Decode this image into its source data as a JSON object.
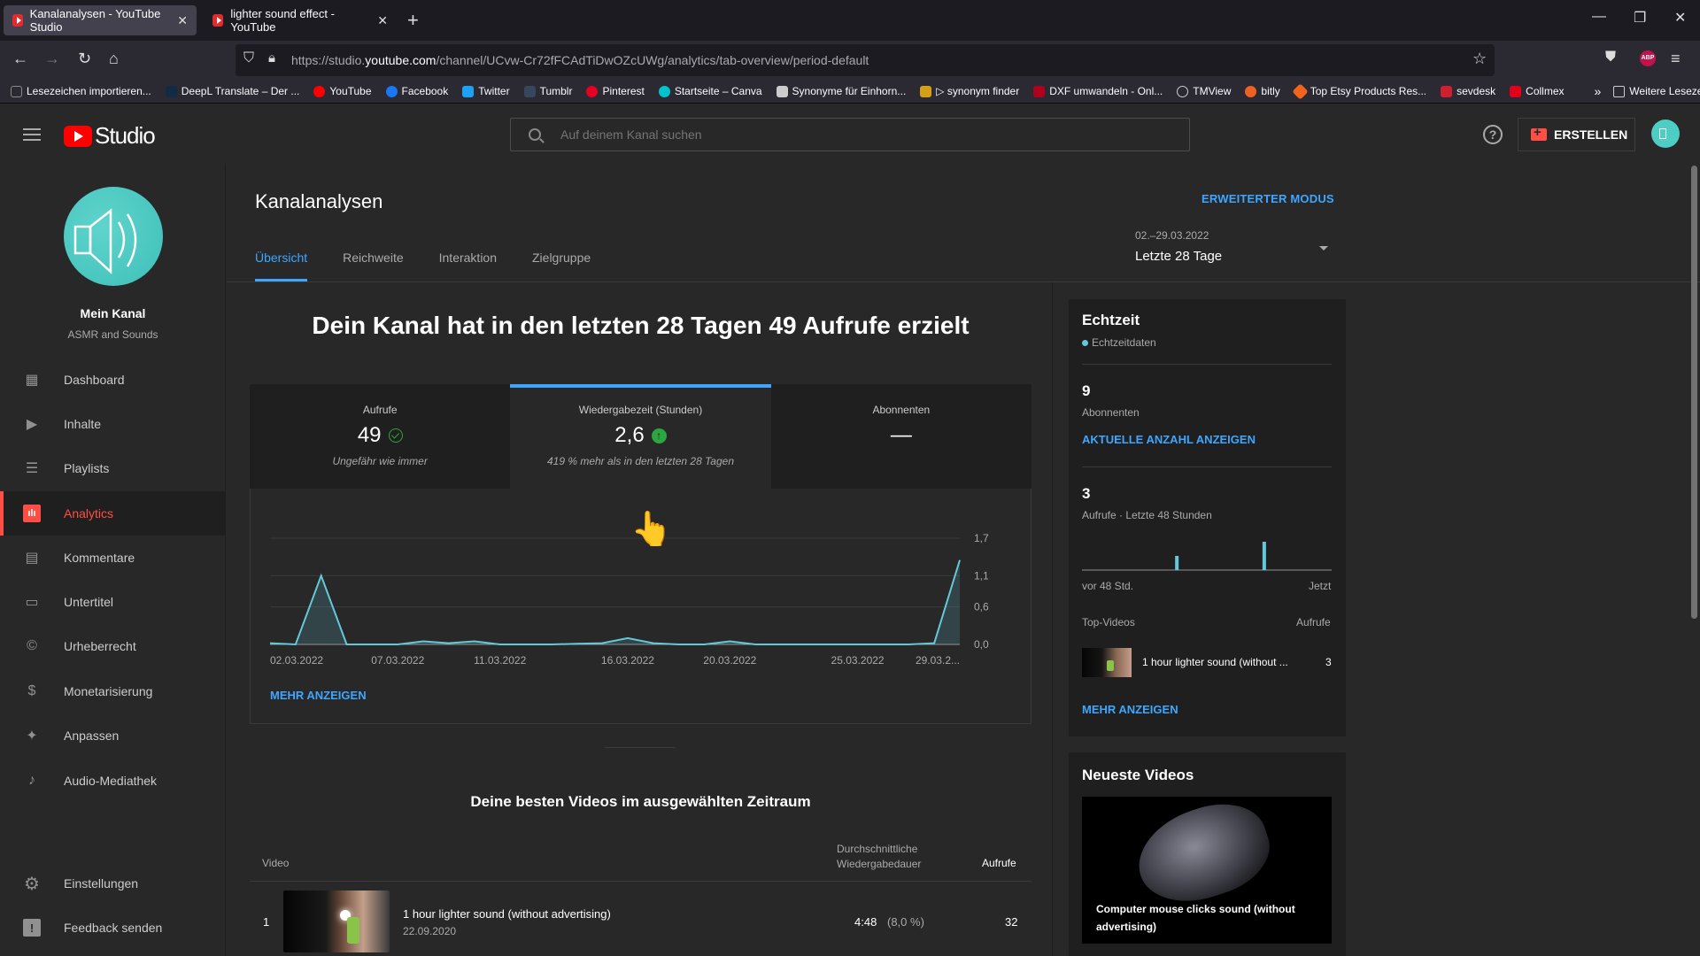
{
  "browser": {
    "tabs": [
      {
        "title": "Kanalanalysen - YouTube Studio",
        "active": true
      },
      {
        "title": "lighter sound effect - YouTube",
        "active": false
      }
    ],
    "url_prefix": "https://studio.",
    "url_domain": "youtube.com",
    "url_path": "/channel/UCvw-Cr72fFCAdTiDwOZcUWg/analytics/tab-overview/period-default",
    "bookmarks": [
      {
        "label": "Lesezeichen importieren...",
        "color": "#888888"
      },
      {
        "label": "DeepL Translate – Der ...",
        "color": "#0f2b46"
      },
      {
        "label": "YouTube",
        "color": "#ff0000"
      },
      {
        "label": "Facebook",
        "color": "#1877f2"
      },
      {
        "label": "Twitter",
        "color": "#1da1f2"
      },
      {
        "label": "Tumblr",
        "color": "#36465d"
      },
      {
        "label": "Pinterest",
        "color": "#e60023"
      },
      {
        "label": "Startseite – Canva",
        "color": "#00c4cc"
      },
      {
        "label": "Synonyme für Einhorn...",
        "color": "#cccccc"
      },
      {
        "label": "▷ synonym finder",
        "color": "#d4a017"
      },
      {
        "label": "DXF umwandeln - Onl...",
        "color": "#b00020"
      },
      {
        "label": "TMView",
        "color": "#cccccc"
      },
      {
        "label": "bitly",
        "color": "#ee6123"
      },
      {
        "label": "Top Etsy Products Res...",
        "color": "#f1641e"
      },
      {
        "label": "sevdesk",
        "color": "#d01f2f"
      },
      {
        "label": "Collmex",
        "color": "#e2001a"
      }
    ],
    "more_bookmarks": "Weitere Lesezeichen"
  },
  "header": {
    "logo_text": "Studio",
    "search_placeholder": "Auf deinem Kanal suchen",
    "create_label": "ERSTELLEN"
  },
  "sidebar": {
    "channel_name": "Mein Kanal",
    "channel_sub": "ASMR and Sounds",
    "items": [
      {
        "label": "Dashboard",
        "icon": "dashboard-icon",
        "glyph": "▦",
        "active": false
      },
      {
        "label": "Inhalte",
        "icon": "content-icon",
        "glyph": "▶",
        "active": false
      },
      {
        "label": "Playlists",
        "icon": "playlist-icon",
        "glyph": "☰",
        "active": false
      },
      {
        "label": "Analytics",
        "icon": "analytics-icon",
        "glyph": "ılı",
        "active": true
      },
      {
        "label": "Kommentare",
        "icon": "comments-icon",
        "glyph": "▤",
        "active": false
      },
      {
        "label": "Untertitel",
        "icon": "subtitles-icon",
        "glyph": "▭",
        "active": false
      },
      {
        "label": "Urheberrecht",
        "icon": "copyright-icon",
        "glyph": "©",
        "active": false
      },
      {
        "label": "Monetarisierung",
        "icon": "dollar-icon",
        "glyph": "$",
        "active": false
      },
      {
        "label": "Anpassen",
        "icon": "magic-wand-icon",
        "glyph": "✦",
        "active": false
      },
      {
        "label": "Audio-Mediathek",
        "icon": "audio-library-icon",
        "glyph": "♪",
        "active": false
      }
    ],
    "bottom_items": [
      {
        "label": "Einstellungen",
        "icon": "gear-icon",
        "glyph": "⚙"
      },
      {
        "label": "Feedback senden",
        "icon": "feedback-icon",
        "glyph": "!"
      }
    ]
  },
  "main": {
    "title": "Kanalanalysen",
    "advanced_mode": "ERWEITERTER MODUS",
    "tabs": [
      {
        "label": "Übersicht",
        "active": true
      },
      {
        "label": "Reichweite",
        "active": false
      },
      {
        "label": "Interaktion",
        "active": false
      },
      {
        "label": "Zielgruppe",
        "active": false
      }
    ],
    "date_range": "02.–29.03.2022",
    "period": "Letzte 28 Tage",
    "headline": "Dein Kanal hat in den letzten 28 Tagen 49 Aufrufe erzielt",
    "metrics": [
      {
        "label": "Aufrufe",
        "value": "49",
        "status": "check",
        "note": "Ungefähr wie immer",
        "selected": false
      },
      {
        "label": "Wiedergabezeit (Stunden)",
        "value": "2,6",
        "status": "up",
        "note": "419 % mehr als in den letzten 28 Tagen",
        "selected": true
      },
      {
        "label": "Abonnenten",
        "value": "—",
        "status": "",
        "note": "",
        "selected": false
      }
    ],
    "show_more": "MEHR ANZEIGEN",
    "best_videos_title": "Deine besten Videos im ausgewählten Zeitraum",
    "table": {
      "col_video": "Video",
      "col_duration_1": "Durchschnittliche",
      "col_duration_2": "Wiedergabedauer",
      "col_views": "Aufrufe",
      "rows": [
        {
          "rank": "1",
          "title": "1 hour lighter sound (without advertising)",
          "date": "22.09.2020",
          "duration": "4:48",
          "pct": "(8,0 %)",
          "views": "32"
        }
      ]
    }
  },
  "realtime": {
    "title": "Echtzeit",
    "live_label": "Echtzeitdaten",
    "subscribers_value": "9",
    "subscribers_label": "Abonnenten",
    "show_count": "AKTUELLE ANZAHL ANZEIGEN",
    "views_value": "3",
    "views_label": "Aufrufe · Letzte 48 Stunden",
    "axis_start": "vor 48 Std.",
    "axis_end": "Jetzt",
    "top_videos_label": "Top-Videos",
    "top_views_label": "Aufrufe",
    "top_video_title": "1 hour lighter sound (without ...",
    "top_video_views": "3",
    "show_more": "MEHR ANZEIGEN"
  },
  "latest": {
    "title": "Neueste Videos",
    "video_title": "Computer mouse clicks sound (without advertising)"
  },
  "colors": {
    "accent": "#3ea6ff",
    "brand_red": "#ff4e45",
    "chart_line": "#65c8d9",
    "positive": "#2ba640"
  },
  "chart_data": [
    {
      "type": "area",
      "title": "Wiedergabezeit (Stunden)",
      "x": [
        "02.03",
        "03.03",
        "04.03",
        "05.03",
        "06.03",
        "07.03",
        "08.03",
        "09.03",
        "10.03",
        "11.03",
        "12.03",
        "13.03",
        "14.03",
        "15.03",
        "16.03",
        "17.03",
        "18.03",
        "19.03",
        "20.03",
        "21.03",
        "22.03",
        "23.03",
        "24.03",
        "25.03",
        "26.03",
        "27.03",
        "28.03",
        "29.03"
      ],
      "values": [
        0.02,
        0.0,
        1.1,
        0.0,
        0.0,
        0.0,
        0.05,
        0.02,
        0.05,
        0.0,
        0.0,
        0.0,
        0.01,
        0.02,
        0.1,
        0.02,
        0.0,
        0.0,
        0.05,
        0.0,
        0.0,
        0.0,
        0.0,
        0.0,
        0.0,
        0.0,
        0.02,
        1.35
      ],
      "x_tick_labels": [
        "02.03.2022",
        "07.03.2022",
        "11.03.2022",
        "16.03.2022",
        "20.03.2022",
        "25.03.2022",
        "29.03.2..."
      ],
      "x_tick_index": [
        0,
        5,
        9,
        14,
        18,
        23,
        27
      ],
      "y_ticks": [
        "0,0",
        "0,6",
        "1,1",
        "1,7"
      ],
      "ylim": [
        0,
        1.7
      ],
      "grid": true
    },
    {
      "type": "bar",
      "title": "Aufrufe · Letzte 48 Stunden",
      "bars": [
        {
          "position": 0.38,
          "value": 1
        },
        {
          "position": 0.73,
          "value": 2
        }
      ],
      "ylim": [
        0,
        2.5
      ]
    }
  ]
}
